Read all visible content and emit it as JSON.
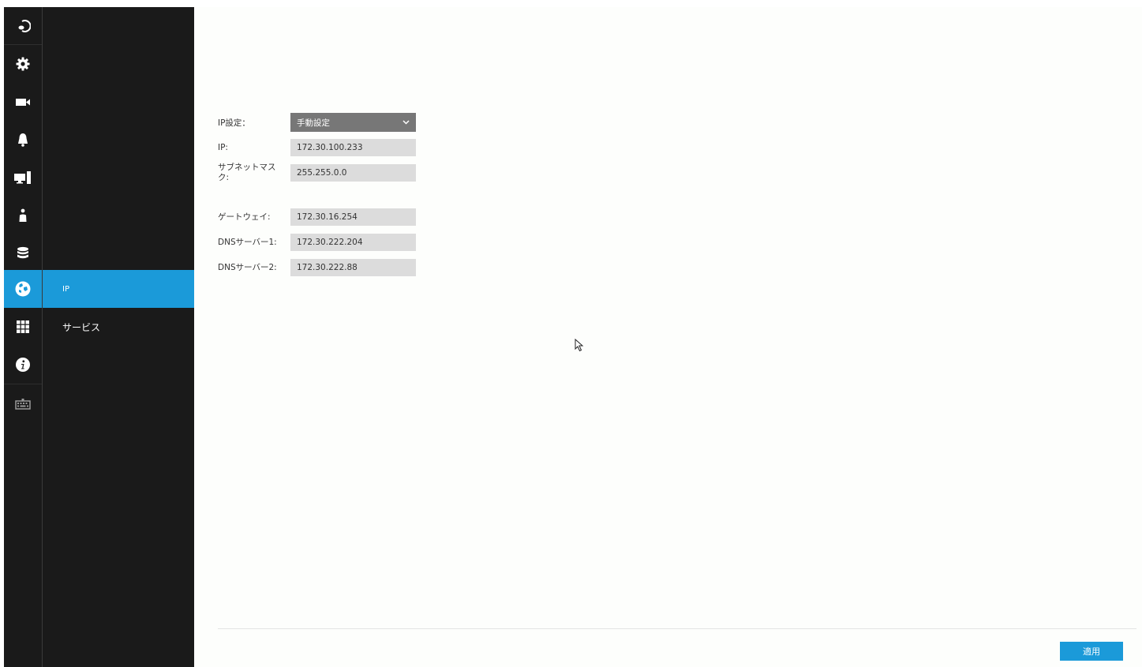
{
  "colors": {
    "accent": "#1b9ad9",
    "sidebar_bg": "#1a1a1a",
    "field_bg": "#dcdcdc",
    "select_bg": "#777777"
  },
  "rail": {
    "items": [
      {
        "icon": "back-icon"
      },
      {
        "icon": "gear-icon"
      },
      {
        "icon": "video-camera-icon"
      },
      {
        "icon": "bell-icon"
      },
      {
        "icon": "monitor-pc-icon"
      },
      {
        "icon": "user-icon"
      },
      {
        "icon": "database-icon"
      },
      {
        "icon": "globe-network-icon",
        "active": true
      },
      {
        "icon": "grid-apps-icon"
      },
      {
        "icon": "info-icon"
      },
      {
        "icon": "keyboard-icon"
      }
    ]
  },
  "submenu": {
    "items": [
      {
        "label": "IP",
        "active": true
      },
      {
        "label": "サービス"
      }
    ]
  },
  "form": {
    "ip_setting_label": "IP設定：",
    "ip_setting_value": "手動設定",
    "ip_label": "IP:",
    "ip_value": "172.30.100.233",
    "subnet_label_line1": "サブネットマス",
    "subnet_label_line2": "ク:",
    "subnet_value": "255.255.0.0",
    "gateway_label": "ゲートウェイ:",
    "gateway_value": "172.30.16.254",
    "dns1_label": "DNSサーバー1:",
    "dns1_value": "172.30.222.204",
    "dns2_label": "DNSサーバー2:",
    "dns2_value": "172.30.222.88"
  },
  "footer": {
    "apply_label": "適用"
  }
}
